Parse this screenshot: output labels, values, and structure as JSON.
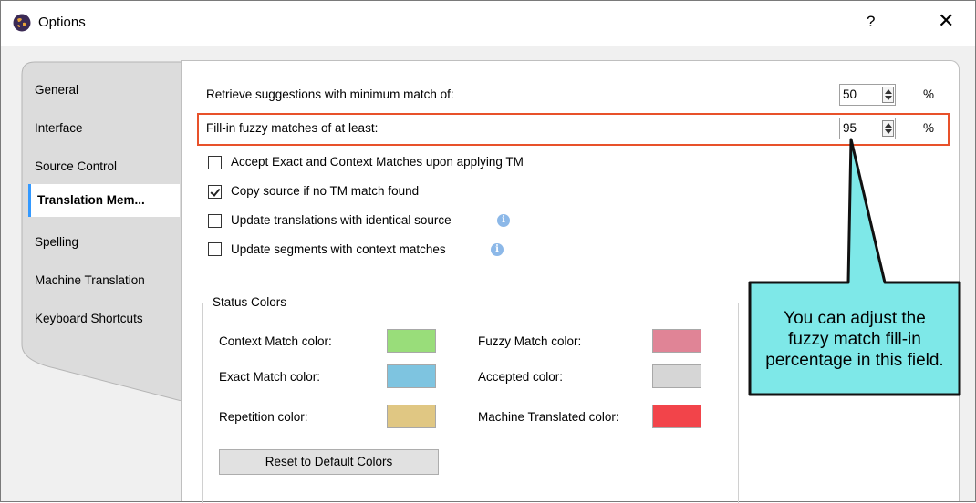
{
  "window": {
    "title": "Options",
    "help_label": "?",
    "close_label": "✕",
    "app_icon": "app-globe-icon"
  },
  "sidebar": {
    "tabs": [
      {
        "label": "General"
      },
      {
        "label": "Interface"
      },
      {
        "label": "Source Control"
      },
      {
        "label": "Translation Mem..."
      },
      {
        "label": "Spelling"
      },
      {
        "label": "Machine Translation"
      },
      {
        "label": "Keyboard Shortcuts"
      }
    ],
    "selected_index": 3
  },
  "settings": {
    "min_match": {
      "label": "Retrieve suggestions with minimum match of:",
      "value": "50",
      "unit": "%"
    },
    "fuzzy_fill": {
      "label": "Fill-in fuzzy matches of at least:",
      "value": "95",
      "unit": "%"
    },
    "checkboxes": [
      {
        "label": "Accept Exact and Context Matches upon applying TM",
        "checked": false,
        "info": false
      },
      {
        "label": "Copy source if no TM match found",
        "checked": true,
        "info": false
      },
      {
        "label": "Update translations with identical source",
        "checked": false,
        "info": true
      },
      {
        "label": "Update segments with context matches",
        "checked": false,
        "info": true
      }
    ],
    "info_glyph": "i"
  },
  "status_colors": {
    "title": "Status Colors",
    "items": [
      {
        "label": "Context Match color:",
        "color": "#99dd7a"
      },
      {
        "label": "Exact Match color:",
        "color": "#7ec4e0"
      },
      {
        "label": "Repetition color:",
        "color": "#e0c783"
      },
      {
        "label": "Fuzzy Match color:",
        "color": "#e08496"
      },
      {
        "label": "Accepted color:",
        "color": "#d6d6d6"
      },
      {
        "label": "Machine Translated color:",
        "color": "#f2444a"
      }
    ],
    "reset_label": "Reset to Default Colors"
  },
  "callout": {
    "lines": [
      "You can adjust the",
      "fuzzy match fill-",
      "in percentage in this field."
    ],
    "line1": "You can adjust the",
    "line2": "fuzzy match fill-in",
    "line3": "percentage in this field.",
    "fill": "#7ee8e8",
    "border": "#111111"
  },
  "colors": {
    "highlight_border": "#e8512a",
    "selected_tab_accent": "#3399ff"
  }
}
